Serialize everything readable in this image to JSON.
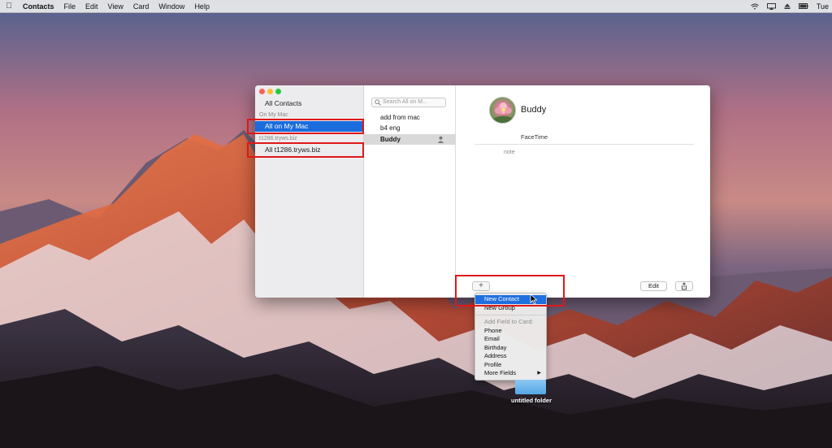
{
  "menubar": {
    "app_name": "Contacts",
    "menus": [
      "File",
      "Edit",
      "View",
      "Card",
      "Window",
      "Help"
    ],
    "clock": "Tue"
  },
  "sidebar": {
    "all_contacts": "All Contacts",
    "section_local": "On My Mac",
    "item_local": "All on My Mac",
    "section_server": "t1286.tryws.biz",
    "item_server": "All t1286.tryws.biz"
  },
  "list": {
    "search_placeholder": "Search All on M...",
    "contacts": [
      "add from mac",
      "b4 eng",
      "Buddy"
    ]
  },
  "detail": {
    "name": "Buddy",
    "facetime": "FaceTime",
    "note_label": "note",
    "edit_label": "Edit",
    "add_label": "+"
  },
  "popup_menu": {
    "new_contact": "New Contact",
    "new_group": "New Group",
    "add_field_header": "Add Field to Card:",
    "fields": [
      "Phone",
      "Email",
      "Birthday",
      "Address",
      "Profile"
    ],
    "more_fields": "More Fields"
  },
  "desktop": {
    "folder_label": "untitled folder"
  },
  "colors": {
    "selection_blue": "#1a6cdd",
    "annotation_red": "#e01818"
  }
}
